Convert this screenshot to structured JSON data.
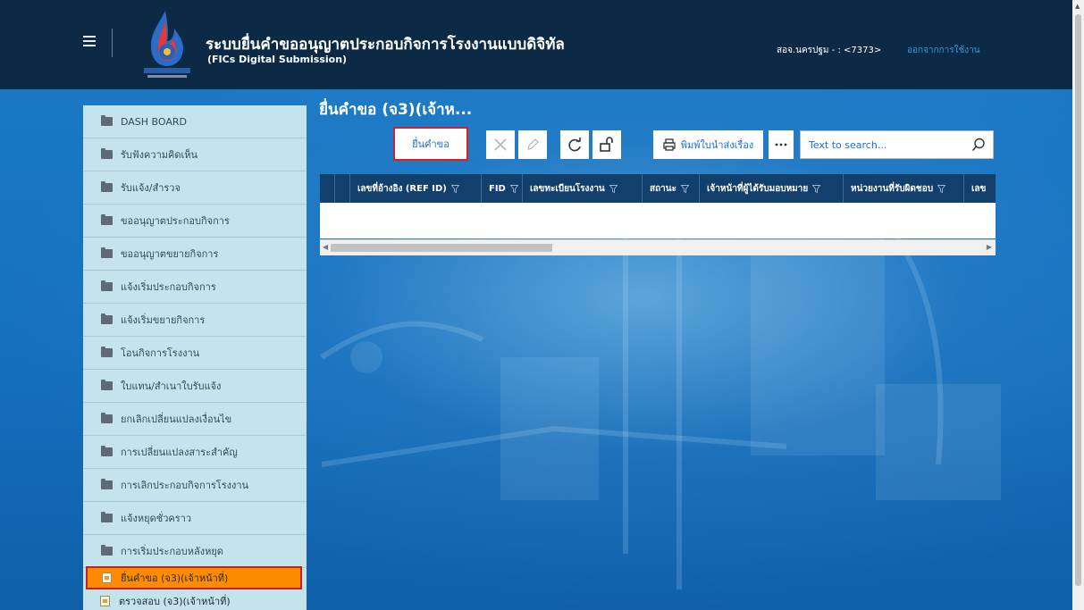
{
  "header": {
    "title": "ระบบยื่นคำขออนุญาตประกอบกิจการโรงงานแบบดิจิทัล",
    "subtitle": "(FICs Digital Submission)",
    "user_info": "สอจ.นครปฐม - : <7373>",
    "logout": "ออกจากการใช้งาน"
  },
  "sidebar": {
    "items": [
      {
        "label": "DASH BOARD"
      },
      {
        "label": "รับฟังความคิดเห็น"
      },
      {
        "label": "รับแจ้ง/สำรวจ"
      },
      {
        "label": "ขออนุญาตประกอบกิจการ"
      },
      {
        "label": "ขออนุญาตขยายกิจการ"
      },
      {
        "label": "แจ้งเริ่มประกอบกิจการ"
      },
      {
        "label": "แจ้งเริ่มขยายกิจการ"
      },
      {
        "label": "โอนกิจการโรงงาน"
      },
      {
        "label": "ใบแทน/สำเนาใบรับแจ้ง"
      },
      {
        "label": "ยกเลิกเปลี่ยนแปลงเงื่อนไข"
      },
      {
        "label": "การเปลี่ยนแปลงสาระสำคัญ"
      },
      {
        "label": "การเลิกประกอบกิจการโรงงาน"
      },
      {
        "label": "แจ้งหยุดชั่วคราว"
      },
      {
        "label": "การเริ่มประกอบหลังหยุด"
      }
    ],
    "sub_items": [
      {
        "label": "ยื่นคำขอ (จ3)(เจ้าหน้าที่)",
        "active": true
      },
      {
        "label": "ตรวจสอบ (จ3)(เจ้าหน้าที่)",
        "active": false
      }
    ]
  },
  "main": {
    "page_title": "ยื่นคำขอ (จ3)(เจ้าห...",
    "toolbar": {
      "submit_label": "ยื่นคำขอ",
      "print_label": "พิมพ์ใบนำส่งเรื่อง",
      "search_placeholder": "Text to search..."
    },
    "grid": {
      "columns": [
        "เลขที่อ้างอิง (REF ID)",
        "FID",
        "เลขทะเบียนโรงงาน",
        "สถานะ",
        "เจ้าหน้าที่ผู้ได้รับมอบหมาย",
        "หน่วยงานที่รับผิดชอบ",
        "เลข"
      ]
    }
  },
  "colors": {
    "header_bg": "#0c2a45",
    "sidebar_bg": "#c4e3eb",
    "active_item": "#ff8c00",
    "grid_header": "#133f6c",
    "link_blue": "#1b6ecf"
  }
}
